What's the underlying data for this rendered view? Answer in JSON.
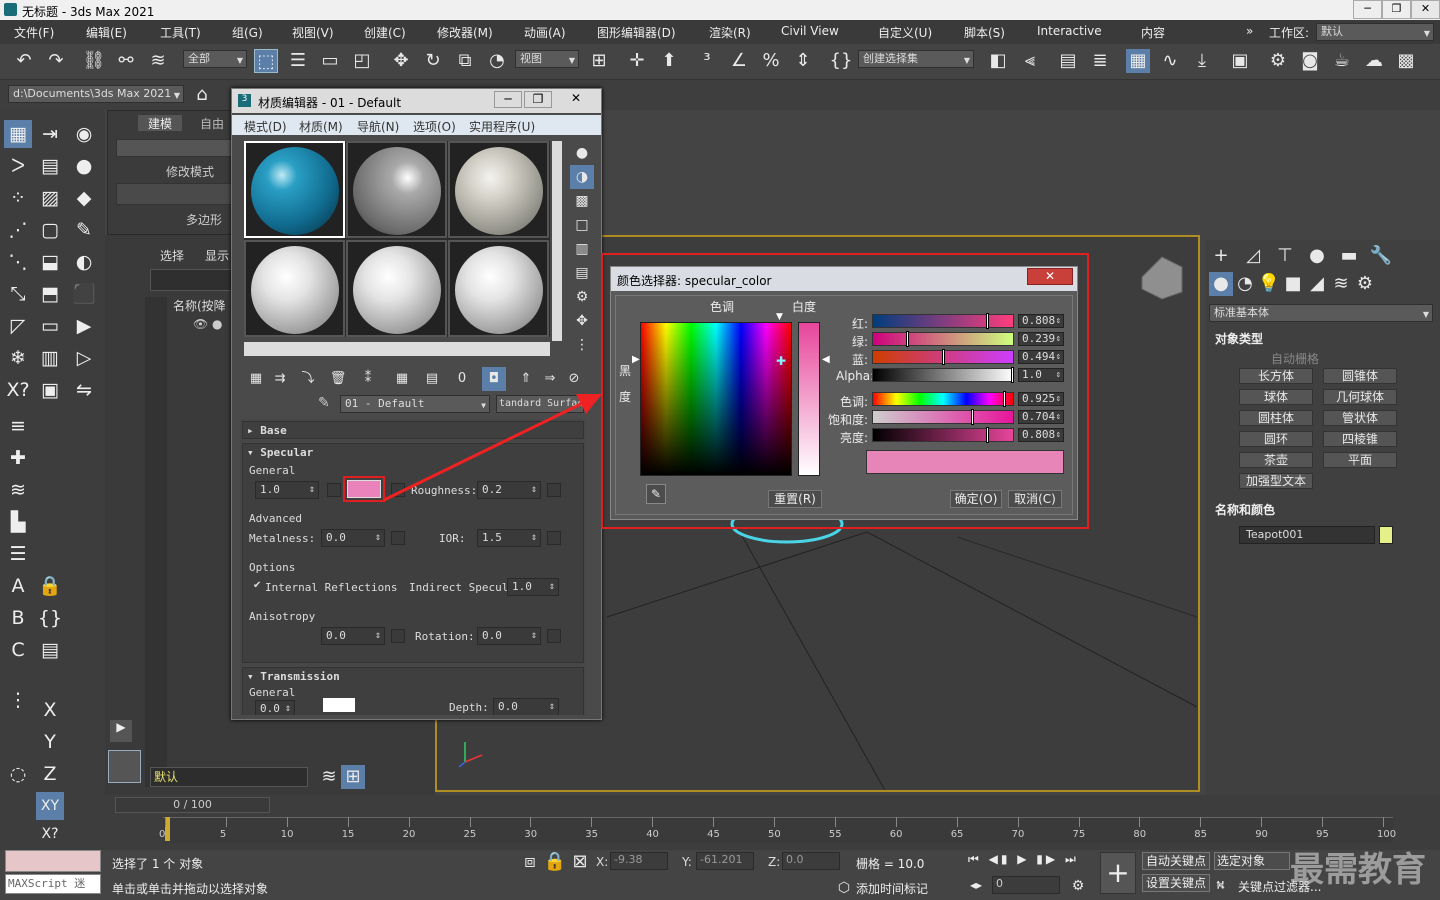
{
  "app": {
    "title": "无标题 - 3ds Max 2021",
    "min": "─",
    "max": "❐",
    "close": "✕"
  },
  "menu": [
    "文件(F)",
    "编辑(E)",
    "工具(T)",
    "组(G)",
    "视图(V)",
    "创建(C)",
    "修改器(M)",
    "动画(A)",
    "图形编辑器(D)",
    "渲染(R)",
    "Civil View",
    "自定义(U)",
    "脚本(S)",
    "Interactive",
    "内容"
  ],
  "workspace": {
    "label": "工作区:",
    "value": "默认"
  },
  "toolbar": {
    "filter": "全部",
    "refcoord": "视图",
    "selset": "创建选择集"
  },
  "project_path": "d:\\Documents\\3ds Max 2021",
  "ribbon": {
    "tab1": "建模",
    "tab2": "自由",
    "mode": "修改模式",
    "poly": "多边形"
  },
  "scene": {
    "tab_select": "选择",
    "tab_display": "显示",
    "name_col": "名称(按降"
  },
  "mat_editor": {
    "title": "材质编辑器 - 01 - Default",
    "menu": [
      "模式(D)",
      "材质(M)",
      "导航(N)",
      "选项(O)",
      "实用程序(U)"
    ],
    "mat_name": "01 - Default",
    "mat_type": "tandard Surface",
    "base": "Base",
    "specular": "Specular",
    "general": "General",
    "spec_value": "1.0",
    "spec_color": "#ea82bb",
    "roughness_label": "Roughness:",
    "roughness": "0.2",
    "advanced": "Advanced",
    "metalness_label": "Metalness:",
    "metalness": "0.0",
    "ior_label": "IOR:",
    "ior": "1.5",
    "options": "Options",
    "internal_refl": "Internal Reflections",
    "indirect_spec_label": "Indirect Specular:",
    "indirect_spec": "1.0",
    "anisotropy": "Anisotropy",
    "aniso_value": "0.0",
    "rotation_label": "Rotation:",
    "rotation": "0.0",
    "transmission": "Transmission",
    "trans_general": "General",
    "trans_value": "0.0",
    "depth_label": "Depth:",
    "depth": "0.0"
  },
  "color_picker": {
    "title": "颜色选择器: specular_color",
    "hue_label": "色调",
    "white_label": "白度",
    "black_label": "黑",
    "degree_label": "度",
    "red_label": "红:",
    "red": "0.808",
    "green_label": "绿:",
    "green": "0.239",
    "blue_label": "蓝:",
    "blue": "0.494",
    "alpha_label": "Alpha:",
    "alpha": "1.0",
    "hue2_label": "色调:",
    "hue": "0.925",
    "sat_label": "饱和度:",
    "sat": "0.704",
    "val_label": "亮度:",
    "val": "0.808",
    "reset": "重置(R)",
    "ok": "确定(O)",
    "cancel": "取消(C)",
    "color": "#e784b8"
  },
  "cmd": {
    "category": "标准基本体",
    "objtype_title": "对象类型",
    "autogrid": "自动栅格",
    "buttons": [
      "长方体",
      "圆锥体",
      "球体",
      "几何球体",
      "圆柱体",
      "管状体",
      "圆环",
      "四棱锥",
      "茶壶",
      "平面",
      "加强型文本"
    ],
    "namecolor_title": "名称和颜色",
    "objname": "Teapot001",
    "objcolor": "#e4f08a"
  },
  "layer": {
    "value": "默认"
  },
  "timeline": {
    "frame": "0 / 100",
    "ticks": [
      "0",
      "5",
      "10",
      "15",
      "20",
      "25",
      "30",
      "35",
      "40",
      "45",
      "50",
      "55",
      "60",
      "65",
      "70",
      "75",
      "80",
      "85",
      "90",
      "95",
      "100"
    ]
  },
  "status": {
    "maxscript": "MAXScript 迷",
    "selected": "选择了 1 个 对象",
    "hint": "单击或单击并拖动以选择对象",
    "x_label": "X:",
    "x": "-9.38",
    "y_label": "Y:",
    "y": "-61.201",
    "z_label": "Z:",
    "z": "0.0",
    "grid": "栅格 = 10.0",
    "addtime": "添加时间标记",
    "autokey": "自动关键点",
    "selobj": "选定对象",
    "setkey": "设置关键点",
    "keyfilter": "关键点过滤器...",
    "curframe": "0",
    "watermark": "最需教育"
  }
}
